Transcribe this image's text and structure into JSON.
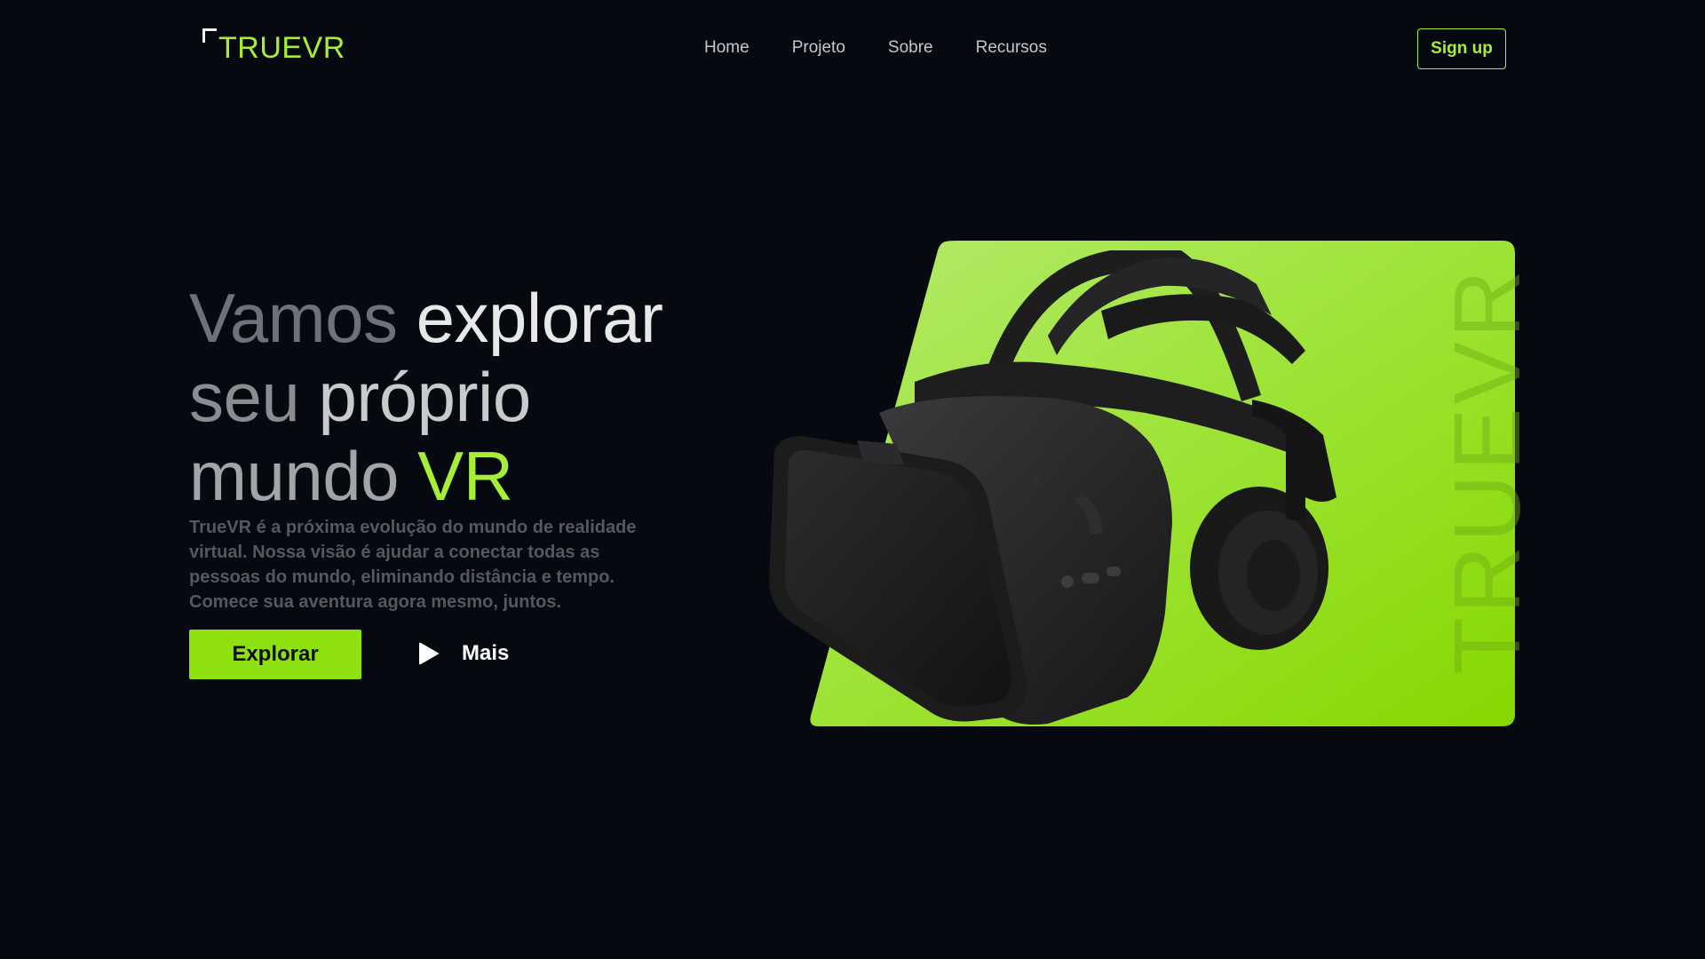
{
  "brand": {
    "name": "TRUEVR",
    "accent": "#a6ee38",
    "panel": "#8fe00f"
  },
  "nav": {
    "items": [
      "Home",
      "Projeto",
      "Sobre",
      "Recursos"
    ],
    "signup_label": "Sign up"
  },
  "hero": {
    "line1": {
      "dim": "Vamos",
      "bright": "explorar"
    },
    "line2": {
      "dim": "seu",
      "bright": "próprio"
    },
    "line3": {
      "dim": "mundo",
      "accent": "VR"
    },
    "description": "TrueVR é a próxima evolução do mundo de realidade virtual. Nossa visão é ajudar a conectar todas as pessoas do mundo, eliminando distância e tempo. Comece sua aventura agora mesmo, juntos.",
    "explore_label": "Explorar",
    "more_label": "Mais",
    "play_icon": "play-icon",
    "watermark": "TRUEVR",
    "product_image": "vr-headset-image"
  }
}
